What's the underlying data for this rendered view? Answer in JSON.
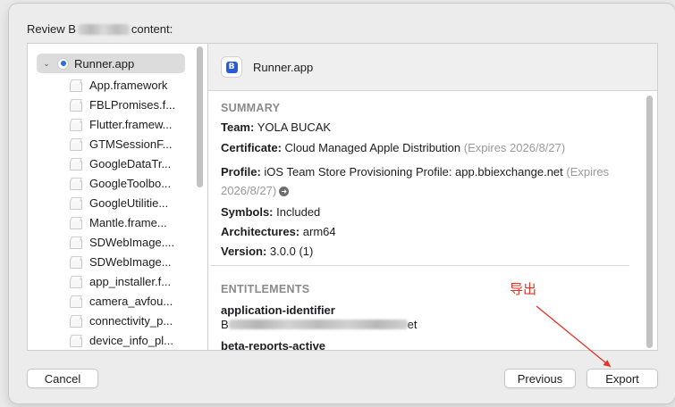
{
  "header": {
    "prefix": "Review B",
    "suffix": "content:"
  },
  "tree": {
    "root": "Runner.app",
    "items": [
      "App.framework",
      "FBLPromises.f...",
      "Flutter.framew...",
      "GTMSessionF...",
      "GoogleDataTr...",
      "GoogleToolbo...",
      "GoogleUtilitie...",
      "Mantle.frame...",
      "SDWebImage....",
      "SDWebImage...",
      "app_installer.f...",
      "camera_avfou...",
      "connectivity_p...",
      "device_info_pl..."
    ]
  },
  "detail": {
    "title": "Runner.app",
    "summary_title": "SUMMARY",
    "team_label": "Team:",
    "team_value": "YOLA BUCAK",
    "cert_label": "Certificate:",
    "cert_value": "Cloud Managed Apple Distribution",
    "cert_expiry": "(Expires 2026/8/27)",
    "profile_label": "Profile:",
    "profile_value": "iOS Team Store Provisioning Profile: app.bbiexchange.net",
    "profile_expiry_1": "(Expires",
    "profile_expiry_2": "2026/8/27)",
    "symbols_label": "Symbols:",
    "symbols_value": "Included",
    "arch_label": "Architectures:",
    "arch_value": "arm64",
    "version_label": "Version:",
    "version_value": "3.0.0 (1)",
    "entitlements_title": "ENTITLEMENTS",
    "ent1_key": "application-identifier",
    "ent1_value_prefix": "B",
    "ent1_value_suffix": "et",
    "ent2_key": "beta-reports-active"
  },
  "buttons": {
    "cancel": "Cancel",
    "previous": "Previous",
    "export": "Export"
  },
  "annotation": {
    "text": "导出",
    "color": "#e53324"
  },
  "icons": {
    "root": "app-icon",
    "items": "framework-box-icon",
    "profile_link": "arrow-right-circle-icon"
  }
}
